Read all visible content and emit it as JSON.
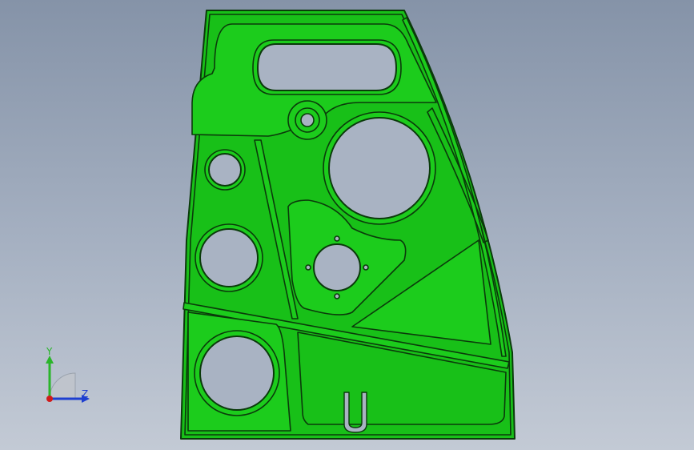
{
  "viewport": {
    "background_top": "#8593a8",
    "background_bottom": "#c3cad5"
  },
  "part": {
    "face_color": "#18c018",
    "edge_color": "#0b3a0b",
    "hole_color": "#a9b3c3"
  },
  "triad": {
    "y_label": "Y",
    "z_label": "Z",
    "y_color": "#2ab52a",
    "z_color": "#1e3fd0",
    "origin_color": "#d11a1a"
  }
}
